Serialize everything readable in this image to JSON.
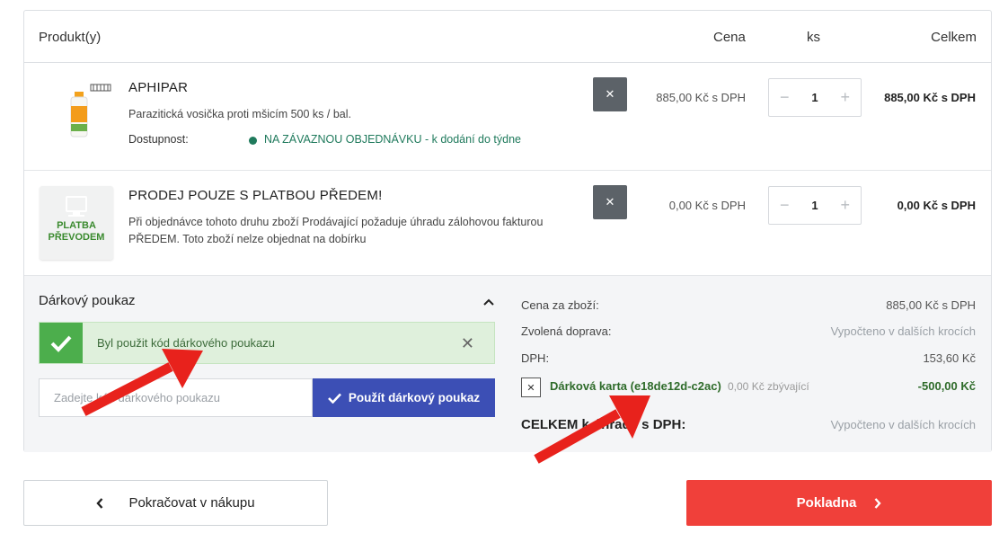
{
  "table_header": {
    "product": "Produkt(y)",
    "price": "Cena",
    "qty": "ks",
    "total": "Celkem"
  },
  "items": [
    {
      "name": "APHIPAR",
      "description": "Parazitická vosička proti mšicím 500 ks / bal.",
      "availability_label": "Dostupnost:",
      "availability": "NA ZÁVAZNOU OBJEDNÁVKU - k dodání do týdne",
      "price": "885,00 Kč s DPH",
      "quantity": "1",
      "total": "885,00 Kč s DPH",
      "remove_icon": "close-icon"
    },
    {
      "name": "PRODEJ POUZE S PLATBOU PŘEDEM!",
      "description_line1": "Při objednávce tohoto druhu zboží Prodávající požaduje úhradu zálohovou fakturou",
      "description_line2": "PŘEDEM. Toto zboží nelze objednat na dobírku",
      "image_text_1": "PLATBA",
      "image_text_2": "PŘEVODEM",
      "price": "0,00 Kč s DPH",
      "quantity": "1",
      "total": "0,00 Kč s DPH",
      "remove_icon": "close-icon"
    }
  ],
  "voucher": {
    "title": "Dárkový poukaz",
    "success_message": "Byl použit kód dárkového poukazu",
    "input_placeholder": "Zadejte kód dárkového poukazu",
    "apply_label": "Použít dárkový poukaz"
  },
  "summary": {
    "goods_label": "Cena za zboží:",
    "goods_value": "885,00 Kč s DPH",
    "shipping_label": "Zvolená doprava:",
    "shipping_value": "Vypočteno v dalších krocích",
    "vat_label": "DPH:",
    "vat_value": "153,60 Kč",
    "gift_card_label": "Dárková karta (e18de12d-c2ac)",
    "gift_card_remaining": "0,00 Kč zbývající",
    "gift_card_amount": "-500,00 Kč",
    "grand_total_label": "CELKEM k úhradě s DPH:",
    "grand_total_value": "Vypočteno v dalších krocích"
  },
  "actions": {
    "continue_label": "Pokračovat v nákupu",
    "checkout_label": "Pokladna"
  },
  "colors": {
    "checkout": "#f0403a",
    "apply_button": "#3c4fb5",
    "success_bg": "#dff0dc",
    "success_icon_bg": "#4cae4c",
    "availability": "#1f7a5c",
    "annotation_arrow": "#e8221c"
  }
}
